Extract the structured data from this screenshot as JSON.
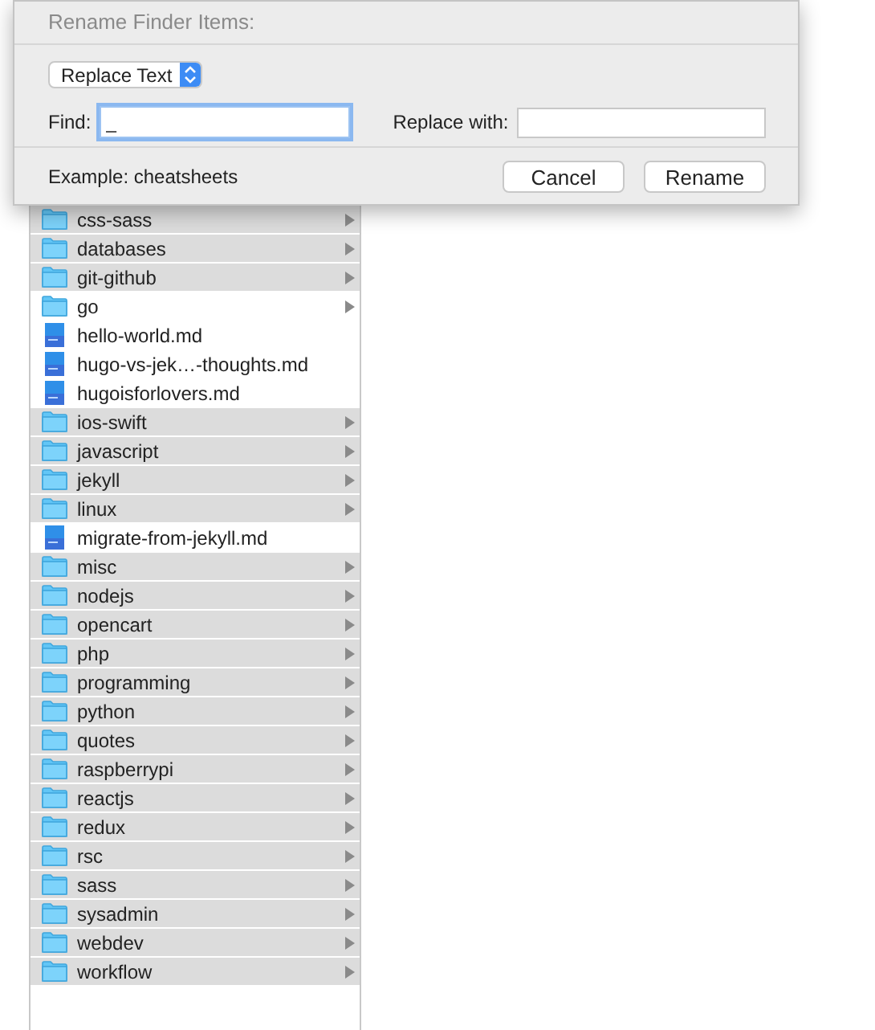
{
  "dialog": {
    "title": "Rename Finder Items:",
    "mode_select": "Replace Text",
    "find": {
      "label": "Find:",
      "value": "_"
    },
    "replace": {
      "label": "Replace with:"
    },
    "example": "Example: cheatsheets",
    "buttons": [
      "Cancel",
      "Rename"
    ]
  },
  "items": [
    {
      "name": "css-sass",
      "kind": "folder",
      "selected": true
    },
    {
      "name": "databases",
      "kind": "folder",
      "selected": true
    },
    {
      "name": "git-github",
      "kind": "folder",
      "selected": true
    },
    {
      "name": "go",
      "kind": "folder",
      "selected": false
    },
    {
      "name": "hello-world.md",
      "kind": "file",
      "selected": false
    },
    {
      "name": "hugo-vs-jek…-thoughts.md",
      "kind": "file",
      "selected": false
    },
    {
      "name": "hugoisforlovers.md",
      "kind": "file",
      "selected": false
    },
    {
      "name": "ios-swift",
      "kind": "folder",
      "selected": true
    },
    {
      "name": "javascript",
      "kind": "folder",
      "selected": true
    },
    {
      "name": "jekyll",
      "kind": "folder",
      "selected": true
    },
    {
      "name": "linux",
      "kind": "folder",
      "selected": true
    },
    {
      "name": "migrate-from-jekyll.md",
      "kind": "file",
      "selected": false
    },
    {
      "name": "misc",
      "kind": "folder",
      "selected": true
    },
    {
      "name": "nodejs",
      "kind": "folder",
      "selected": true
    },
    {
      "name": "opencart",
      "kind": "folder",
      "selected": true
    },
    {
      "name": "php",
      "kind": "folder",
      "selected": true
    },
    {
      "name": "programming",
      "kind": "folder",
      "selected": true
    },
    {
      "name": "python",
      "kind": "folder",
      "selected": true
    },
    {
      "name": "quotes",
      "kind": "folder",
      "selected": true
    },
    {
      "name": "raspberrypi",
      "kind": "folder",
      "selected": true
    },
    {
      "name": "reactjs",
      "kind": "folder",
      "selected": true
    },
    {
      "name": "redux",
      "kind": "folder",
      "selected": true
    },
    {
      "name": "rsc",
      "kind": "folder",
      "selected": true
    },
    {
      "name": "sass",
      "kind": "folder",
      "selected": true
    },
    {
      "name": "sysadmin",
      "kind": "folder",
      "selected": true
    },
    {
      "name": "webdev",
      "kind": "folder",
      "selected": true
    },
    {
      "name": "workflow",
      "kind": "folder",
      "selected": true
    }
  ]
}
